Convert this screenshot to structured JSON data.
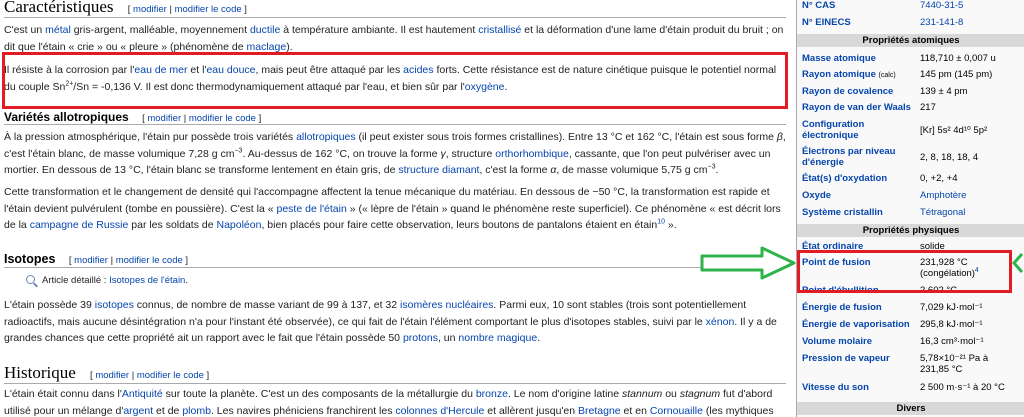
{
  "edit": {
    "modify": "modifier",
    "modify_code": "modifier le code",
    "sep": " | ",
    "open": "[ ",
    "close": " ]"
  },
  "sections": {
    "caracteristiques": "Caractéristiques",
    "allotropiques": "Variétés allotropiques",
    "isotopes": "Isotopes",
    "historique": "Historique"
  },
  "para1": {
    "t1": "C'est un ",
    "l1": "métal",
    "t2": " gris-argent, malléable, moyennement ",
    "l2": "ductile",
    "t3": " à température ambiante. Il est hautement ",
    "l3": "cristallisé",
    "t4": " et la déformation d'une lame d'étain produit du bruit ; on dit que l'étain « crie » ou « pleure » (phénomène de ",
    "l4": "maclage",
    "t5": ")."
  },
  "para2": {
    "t1": "Il résiste à la corrosion par l'",
    "l1": "eau de mer",
    "t2": " et l'",
    "l2": "eau douce",
    "t3": ", mais peut être attaqué par les ",
    "l3": "acides",
    "t4": " forts. Cette résistance est de nature cinétique puisque le potentiel normal du couple Sn",
    "sup1": "2+",
    "t5": "/Sn = -0,136 V. Il est donc thermodynamiquement attaqué par l'eau, et bien sûr par l'",
    "l4": "oxygène",
    "t6": "."
  },
  "para3": {
    "t1": "À la pression atmosphérique, l'étain pur possède trois variétés ",
    "l1": "allotropiques",
    "t2": " (il peut exister sous trois formes cristallines). Entre 13 °C et 162 °C, l'étain est sous forme ",
    "beta": "β",
    "t3": ", c'est l'étain blanc, de masse volumique 7,28 g cm",
    "sup1": "−3",
    "t4": ". Au-dessus de 162 °C, on trouve la forme ",
    "gamma": "γ",
    "t5": ", structure ",
    "l2": "orthorhombique",
    "t6": ", cassante, que l'on peut pulvériser avec un mortier. En dessous de 13 °C, l'étain blanc se transforme lentement en étain gris, de ",
    "l3": "structure diamant",
    "t7": ", c'est la forme ",
    "alpha": "α",
    "t8": ", de masse volumique 5,75 g cm",
    "sup2": "−3",
    "t9": "."
  },
  "para4": {
    "t1": "Cette transformation et le changement de densité qui l'accompagne affectent la tenue mécanique du matériau. En dessous de −50 °C, la transformation est rapide et l'étain devient pulvérulent (tombe en poussière). C'est la « ",
    "l1": "peste de l'étain",
    "t2": " » (« lèpre de l'étain » quand le phénomène reste superficiel). Ce phénomène « est décrit lors de la ",
    "l2": "campagne de Russie",
    "t3": " par les soldats de ",
    "l3": "Napoléon",
    "t4": ", bien placés pour faire cette observation, leurs boutons de pantalons étaient en étain",
    "sup1": "10",
    "t5": " »."
  },
  "isotopes_main": {
    "prefix": "Article détaillé : ",
    "link": "Isotopes de l'étain",
    "suffix": "."
  },
  "para5": {
    "t1": "L'étain possède 39 ",
    "l1": "isotopes",
    "t2": " connus, de nombre de masse variant de 99 à 137, et 32 ",
    "l2": "isomères nucléaires",
    "t3": ". Parmi eux, 10 sont stables (trois sont potentiellement radioactifs, mais aucune désintégration n'a pour l'instant été observée), ce qui fait de l'étain l'élément comportant le plus d'isotopes stables, suivi par le ",
    "l3": "xénon",
    "t4": ". Il y a de grandes chances que cette propriété ait un rapport avec le fait que l'étain possède 50 ",
    "l4": "protons",
    "t5": ", un ",
    "l5": "nombre magique",
    "t6": "."
  },
  "para6": {
    "t1": "L'étain était connu dans l'",
    "l1": "Antiquité",
    "t2": " sur toute la planète. C'est un des composants de la métallurgie du ",
    "l2": "bronze",
    "t3": ". Le nom d'origine latine ",
    "i1": "stannum",
    "t4": " ou ",
    "i2": "stagnum",
    "t5": " fut d'abord utilisé pour un mélange d'",
    "l3": "argent",
    "t6": " et de ",
    "l4": "plomb",
    "t7": ". Les navires phéniciens franchirent les ",
    "l5": "colonnes d'Hercule",
    "t8": " et allèrent jusqu'en ",
    "l6": "Bretagne",
    "t9": " et en ",
    "l7": "Cornouaille",
    "t10": " (les mythiques"
  },
  "infobox": {
    "cas_label": "N° CAS",
    "cas_value": "7440-31-5",
    "einecs_label": "N° EINECS",
    "einecs_value": "231-141-8",
    "sec_atomic": "Propriétés atomiques",
    "masse_label": "Masse atomique",
    "masse_value": "118,710 ± 0,007 u",
    "rayon_label": "Rayon atomique",
    "rayon_small": "(calc)",
    "rayon_value": "145 pm (145 pm)",
    "cov_label": "Rayon de covalence",
    "cov_value": "139 ± 4 pm",
    "vdw_label": "Rayon de van der Waals",
    "vdw_value": "217",
    "config_label": "Configuration électronique",
    "config_value": "[Kr] 5s² 4d¹⁰ 5p²",
    "electrons_label": "Électrons par niveau d'énergie",
    "electrons_value": "2, 8, 18, 18, 4",
    "oxyd_label": "État(s) d'oxydation",
    "oxyd_value": "0, +2, +4",
    "oxyde_label": "Oxyde",
    "oxyde_value": "Amphotère",
    "cristal_label": "Système cristallin",
    "cristal_value": "Tétragonal",
    "sec_physical": "Propriétés physiques",
    "etat_label": "État ordinaire",
    "etat_value": "solide",
    "fusion_label": "Point de fusion",
    "fusion_value": "231,928 °C",
    "fusion_value2": "(congélation)",
    "fusion_ref": "4",
    "ebull_label": "Point d'ébullition",
    "ebull_value": "2 602 °C",
    "efusion_label": "Énergie de fusion",
    "efusion_value": "7,029 kJ·mol⁻¹",
    "evap_label": "Énergie de vaporisation",
    "evap_value": "295,8 kJ·mol⁻¹",
    "vmol_label": "Volume molaire",
    "vmol_value": "16,3 cm³·mol⁻¹",
    "pvap_label": "Pression de vapeur",
    "pvap_value": "5,78×10⁻²¹ Pa à",
    "pvap_value2": "231,85 °C",
    "son_label": "Vitesse du son",
    "son_value": "2 500 m·s⁻¹ à 20 °C",
    "sec_divers": "Divers"
  },
  "colors": {
    "highlight_box": "#e31b23",
    "arrow": "#2db34a",
    "link": "#0645ad"
  }
}
